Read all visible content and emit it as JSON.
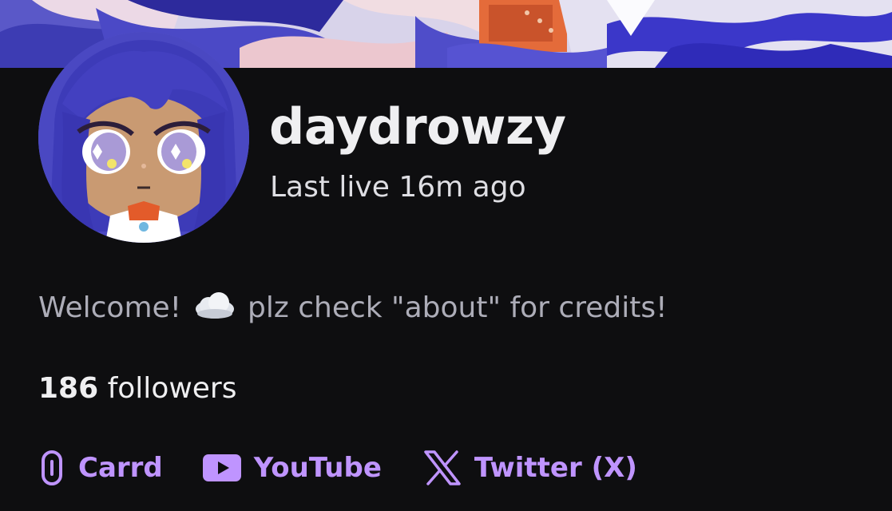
{
  "channel": {
    "username": "daydrowzy",
    "last_live": "Last live 16m ago",
    "bio_before": "Welcome!",
    "bio_emoji": "cloud-emoji",
    "bio_after": "plz check \"about\" for credits!",
    "followers_count": "186",
    "followers_label": "followers"
  },
  "links": [
    {
      "label": "Carrd",
      "icon": "carrd-icon"
    },
    {
      "label": "YouTube",
      "icon": "youtube-icon"
    },
    {
      "label": "Twitter (X)",
      "icon": "x-twitter-icon"
    }
  ],
  "colors": {
    "background": "#0e0e10",
    "link_accent": "#bf94ff",
    "text_primary": "#efeff1",
    "text_secondary": "#adadb8"
  }
}
